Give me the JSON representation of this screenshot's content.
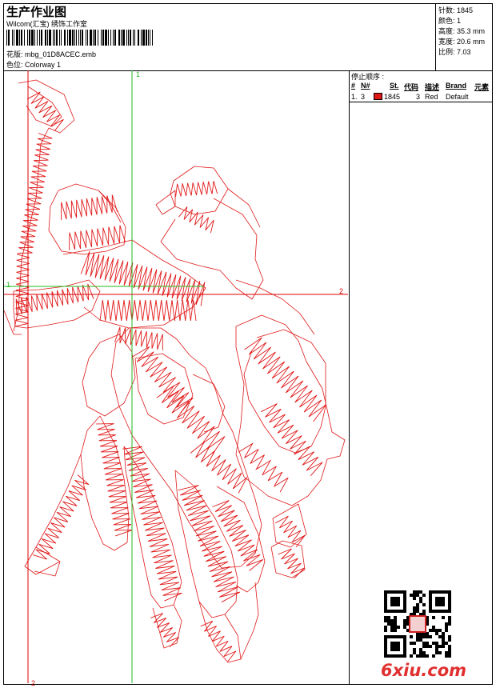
{
  "header": {
    "title": "生产作业图",
    "company": "Wilcom(汇宝) 绣饰工作室",
    "design_label": "花版: mbg_01D8ACEC.emb",
    "colorway_label": "色位: Colorway 1"
  },
  "stats": [
    {
      "text": "针数: 1845"
    },
    {
      "text": "颜色: 1"
    },
    {
      "text": "高度: 35.3 mm"
    },
    {
      "text": "宽度: 20.6 mm"
    },
    {
      "text": "比例: 7.03"
    }
  ],
  "stop_sequence": {
    "title": "停止顺序 :",
    "headers": [
      "#",
      "N#",
      "St.",
      "代码",
      "描述",
      "Brand",
      "元素"
    ],
    "rows": [
      {
        "index": "1.",
        "needle": "3",
        "stitches": "1845",
        "code": "3",
        "description": "Red",
        "brand": "Default",
        "element": ""
      }
    ]
  },
  "design_axes": {
    "green_top": "1",
    "green_left": "1",
    "red_right": "2",
    "red_bottom": "2"
  },
  "colors": {
    "thread": "#e01818",
    "axis_green": "#22bb22",
    "axis_red": "#dd0000"
  },
  "watermark": {
    "site": "6xiu.com"
  }
}
